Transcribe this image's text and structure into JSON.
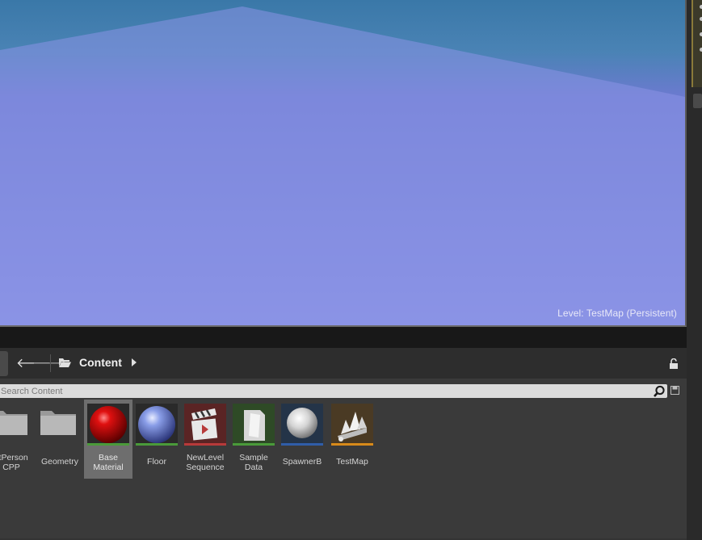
{
  "viewport": {
    "level_label": "Level:  TestMap (Persistent)",
    "colors": {
      "sky": "#3a78a8",
      "floor": "#8b93e6",
      "pyramid": "#cc0000",
      "shadow": "#111111"
    }
  },
  "content_browser": {
    "path": {
      "root_label": "Content"
    },
    "search": {
      "placeholder": "Search Content",
      "value": ""
    },
    "assets": [
      {
        "label": "stPerson\nCPP",
        "type": "folder"
      },
      {
        "label": "Geometry",
        "type": "folder"
      },
      {
        "label": "Base\nMaterial",
        "type": "material",
        "bar_color": "#4a9a3a",
        "selected": true
      },
      {
        "label": "Floor",
        "type": "material",
        "bar_color": "#4a9a3a"
      },
      {
        "label": "NewLevel\nSequence",
        "type": "level-sequence",
        "bar_color": "#b83a3a"
      },
      {
        "label": "Sample\nData",
        "type": "data-asset",
        "bar_color": "#4a9a3a"
      },
      {
        "label": "SpawnerB",
        "type": "blueprint",
        "bar_color": "#2f5da8"
      },
      {
        "label": "TestMap",
        "type": "level",
        "bar_color": "#d88a1a"
      }
    ]
  }
}
